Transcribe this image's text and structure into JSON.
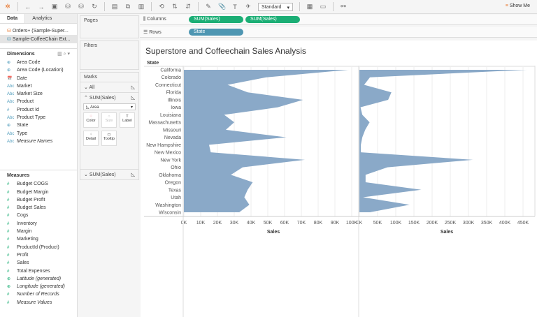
{
  "toolbar": {
    "view_mode": "Standard",
    "show_me": "Show Me"
  },
  "data_pane": {
    "tabs": [
      "Data",
      "Analytics"
    ],
    "datasources": [
      "Orders+ (Sample-Super...",
      "Sample-CoffeeChain Ext..."
    ],
    "dimensions_label": "Dimensions",
    "dimensions": [
      {
        "icon": "globe",
        "label": "Area Code"
      },
      {
        "icon": "globe",
        "label": "Area Code (Location)"
      },
      {
        "icon": "calendar",
        "label": "Date"
      },
      {
        "icon": "abc",
        "label": "Market"
      },
      {
        "icon": "abc",
        "label": "Market Size"
      },
      {
        "icon": "abc",
        "label": "Product"
      },
      {
        "icon": "hash",
        "label": "Product Id"
      },
      {
        "icon": "abc",
        "label": "Product Type"
      },
      {
        "icon": "globe",
        "label": "State"
      },
      {
        "icon": "abc",
        "label": "Type"
      },
      {
        "icon": "abc",
        "label": "Measure Names",
        "italic": true
      }
    ],
    "measures_label": "Measures",
    "measures": [
      {
        "icon": "hash",
        "label": "Budget COGS"
      },
      {
        "icon": "hash",
        "label": "Budget Margin"
      },
      {
        "icon": "hash",
        "label": "Budget Profit"
      },
      {
        "icon": "hash",
        "label": "Budget Sales"
      },
      {
        "icon": "hash",
        "label": "Cogs"
      },
      {
        "icon": "hash",
        "label": "Inventory"
      },
      {
        "icon": "hash",
        "label": "Margin"
      },
      {
        "icon": "hash",
        "label": "Marketing"
      },
      {
        "icon": "hash",
        "label": "ProductId (Product)"
      },
      {
        "icon": "hash",
        "label": "Profit"
      },
      {
        "icon": "hash",
        "label": "Sales"
      },
      {
        "icon": "hash",
        "label": "Total Expenses"
      },
      {
        "icon": "globe",
        "label": "Latitude (generated)",
        "italic": true
      },
      {
        "icon": "globe",
        "label": "Longitude (generated)",
        "italic": true
      },
      {
        "icon": "hash",
        "label": "Number of Records",
        "italic": true
      },
      {
        "icon": "hash",
        "label": "Measure Values",
        "italic": true
      }
    ]
  },
  "cards": {
    "pages": "Pages",
    "filters": "Filters",
    "marks": "Marks",
    "all": "All",
    "sum1": "SUM(Sales)",
    "sum2": "SUM(Sales)",
    "mark_type": "Area",
    "buttons": [
      "Color",
      "Size",
      "Label",
      "Detail",
      "Tooltip"
    ]
  },
  "shelves": {
    "columns_label": "Columns",
    "columns": [
      "SUM(Sales)",
      "SUM(Sales)"
    ],
    "rows_label": "Rows",
    "rows": [
      "State"
    ]
  },
  "colors": {
    "area": "#8aa9c8",
    "columns_pill": "#1bae75",
    "rows_pill": "#4e96b2"
  },
  "chart_data": [
    {
      "type": "area",
      "title": "Superstore and Coffeechain Sales Analysis",
      "ylabel": "State",
      "xlabel": "Sales",
      "orientation": "horizontal",
      "categories": [
        "California",
        "Colorado",
        "Connecticut",
        "Florida",
        "Illinois",
        "Iowa",
        "Louisiana",
        "Massachusetts",
        "Missouri",
        "Nevada",
        "New Hampshire",
        "New Mexico",
        "New York",
        "Ohio",
        "Oklahoma",
        "Oregon",
        "Texas",
        "Utah",
        "Washington",
        "Wisconsin"
      ],
      "values": [
        98000,
        49000,
        26000,
        38000,
        71000,
        56000,
        24000,
        30000,
        25000,
        61000,
        15000,
        16000,
        72000,
        35000,
        28000,
        41000,
        38000,
        36000,
        39000,
        33000
      ],
      "xlim": [
        0,
        100000
      ],
      "ticks": [
        "0K",
        "10K",
        "20K",
        "30K",
        "40K",
        "50K",
        "60K",
        "70K",
        "80K",
        "90K",
        "100K"
      ],
      "grid": true
    },
    {
      "type": "area",
      "xlabel": "Sales",
      "orientation": "horizontal",
      "values": [
        460000,
        29000,
        13000,
        88000,
        79000,
        3000,
        8000,
        28000,
        16000,
        8000,
        4000,
        4000,
        312000,
        77000,
        17000,
        17000,
        170000,
        10000,
        138000,
        29000
      ],
      "xlim": [
        0,
        450000
      ],
      "ticks": [
        "0K",
        "50K",
        "100K",
        "150K",
        "200K",
        "250K",
        "300K",
        "350K",
        "400K",
        "450K"
      ],
      "grid": true
    }
  ]
}
